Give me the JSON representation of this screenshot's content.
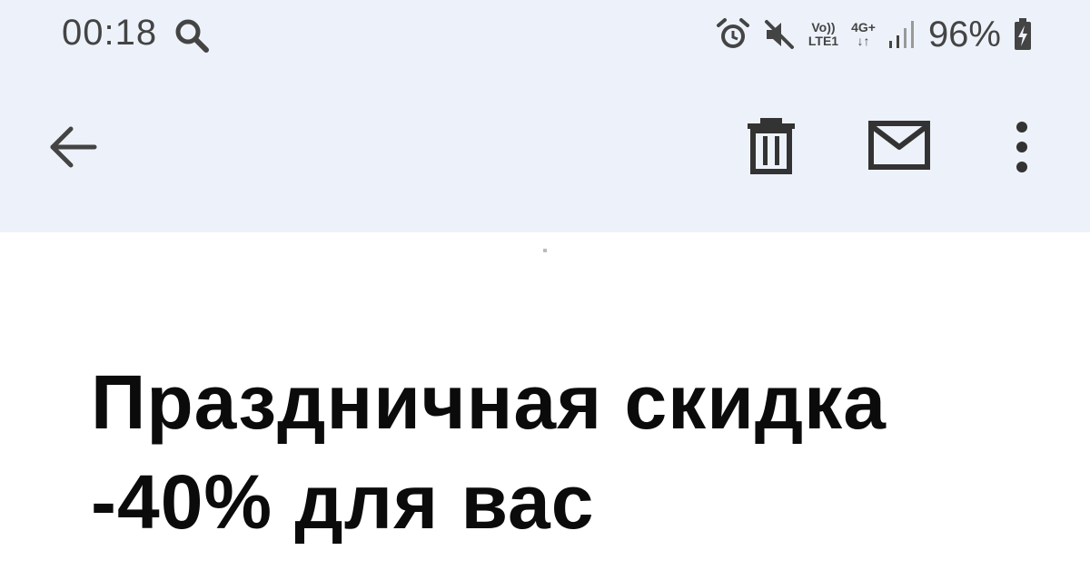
{
  "status_bar": {
    "time": "00:18",
    "network_volte": "Vo))",
    "network_lte": "LTE1",
    "network_4g": "4G+",
    "network_arrows": "↓↑",
    "battery_percent": "96%",
    "icons": [
      "search-icon",
      "alarm-icon",
      "mute-icon",
      "signal-icon",
      "battery-charging-icon"
    ]
  },
  "toolbar": {
    "icons": [
      "back-arrow-icon",
      "trash-icon",
      "mail-icon",
      "more-vert-icon"
    ]
  },
  "email": {
    "subject_line1": "Праздничная скидка",
    "subject_line2": "-40% для вас"
  },
  "colors": {
    "header_bg": "#edf2fa",
    "body_bg": "#ffffff",
    "icon": "#333333"
  }
}
